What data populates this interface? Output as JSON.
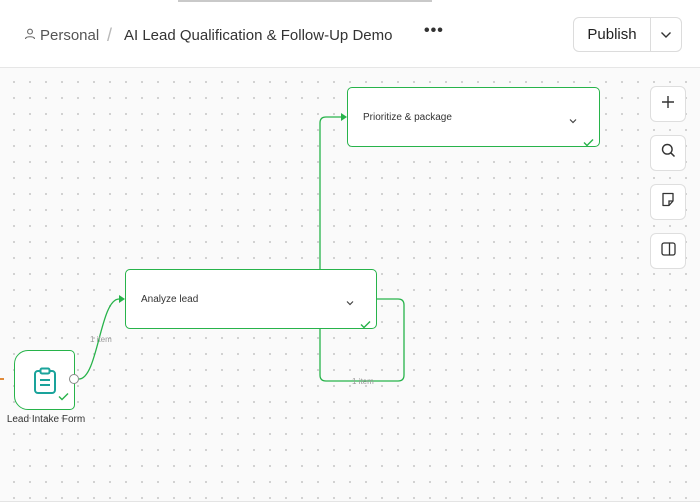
{
  "header": {
    "workspace": "Personal",
    "separator": "/",
    "workflow_title": "AI Lead Qualification & Follow-Up Demo",
    "more_label": "•••",
    "publish_label": "Publish"
  },
  "nodes": {
    "trigger": {
      "label": "Lead Intake Form",
      "status": "success"
    },
    "analyze": {
      "title": "Analyze lead",
      "status": "success"
    },
    "prioritize": {
      "title": "Prioritize & package",
      "status": "success"
    }
  },
  "edges": [
    {
      "from": "Lead Intake Form",
      "to": "Analyze lead",
      "label": "1 item"
    },
    {
      "from": "Analyze lead",
      "to": "Prioritize & package",
      "label": "1 item"
    }
  ],
  "toolbar": {
    "buttons": [
      "zoom-in",
      "search",
      "sticky-note",
      "side-panel"
    ]
  },
  "colors": {
    "success_green": "#27b34a",
    "icon_teal": "#1aa39b"
  }
}
